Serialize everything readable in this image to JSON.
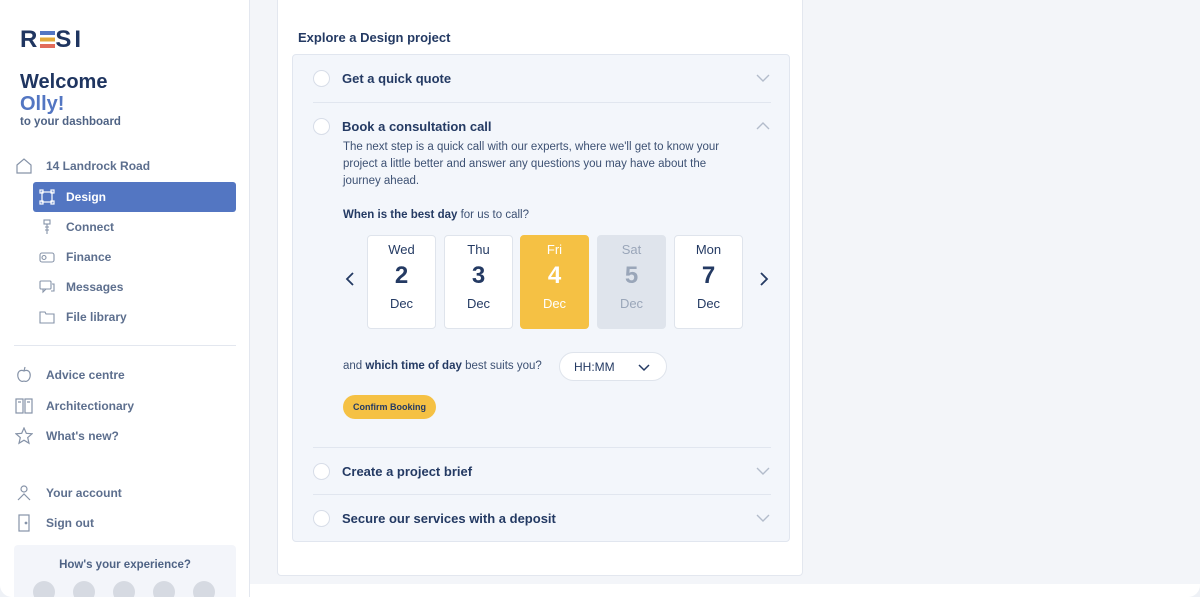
{
  "sidebar": {
    "logo": {
      "letters": [
        "R",
        "E",
        "S",
        "I"
      ]
    },
    "welcome": "Welcome",
    "user_name": "Olly!",
    "welcome_sub": "to your dashboard",
    "property": {
      "label": "14 Landrock Road",
      "icon": "house-icon"
    },
    "property_items": [
      {
        "label": "Design",
        "icon": "design-frame-icon",
        "active": true
      },
      {
        "label": "Connect",
        "icon": "connect-icon",
        "active": false
      },
      {
        "label": "Finance",
        "icon": "finance-icon",
        "active": false
      },
      {
        "label": "Messages",
        "icon": "messages-icon",
        "active": false
      },
      {
        "label": "File library",
        "icon": "folder-icon",
        "active": false
      }
    ],
    "links": [
      {
        "label": "Advice centre",
        "icon": "apple-icon"
      },
      {
        "label": "Architectionary",
        "icon": "book-icon"
      },
      {
        "label": "What's new?",
        "icon": "star-icon"
      }
    ],
    "account_links": [
      {
        "label": "Your account",
        "icon": "person-icon"
      },
      {
        "label": "Sign out",
        "icon": "door-icon"
      }
    ],
    "experience_title": "How's your experience?"
  },
  "main": {
    "title": "Explore a Design project",
    "steps": [
      {
        "label": "Get a quick quote",
        "expanded": false
      },
      {
        "label": "Book a consultation call",
        "expanded": true
      },
      {
        "label": "Create a project brief",
        "expanded": false
      },
      {
        "label": "Secure our services with a deposit",
        "expanded": false
      }
    ],
    "consultation": {
      "description": "The next step is a quick call with our experts, where we'll get to know your project a little better and answer any questions you may have about the journey ahead.",
      "day_question_bold": "When is the best day",
      "day_question_rest": " for us to call?",
      "days": [
        {
          "dow": "Wed",
          "num": "2",
          "month": "Dec",
          "state": "normal"
        },
        {
          "dow": "Thu",
          "num": "3",
          "month": "Dec",
          "state": "normal"
        },
        {
          "dow": "Fri",
          "num": "4",
          "month": "Dec",
          "state": "selected"
        },
        {
          "dow": "Sat",
          "num": "5",
          "month": "Dec",
          "state": "disabled"
        },
        {
          "dow": "Mon",
          "num": "7",
          "month": "Dec",
          "state": "normal"
        }
      ],
      "time_question_pre": "and ",
      "time_question_bold": "which time of day",
      "time_question_post": " best suits you?",
      "time_placeholder": "HH:MM",
      "confirm_label": "Confirm Booking"
    }
  },
  "colors": {
    "primary": "#5376c2",
    "accent": "#f5c144",
    "text": "#243a63",
    "disabled": "#dfe4ec"
  }
}
